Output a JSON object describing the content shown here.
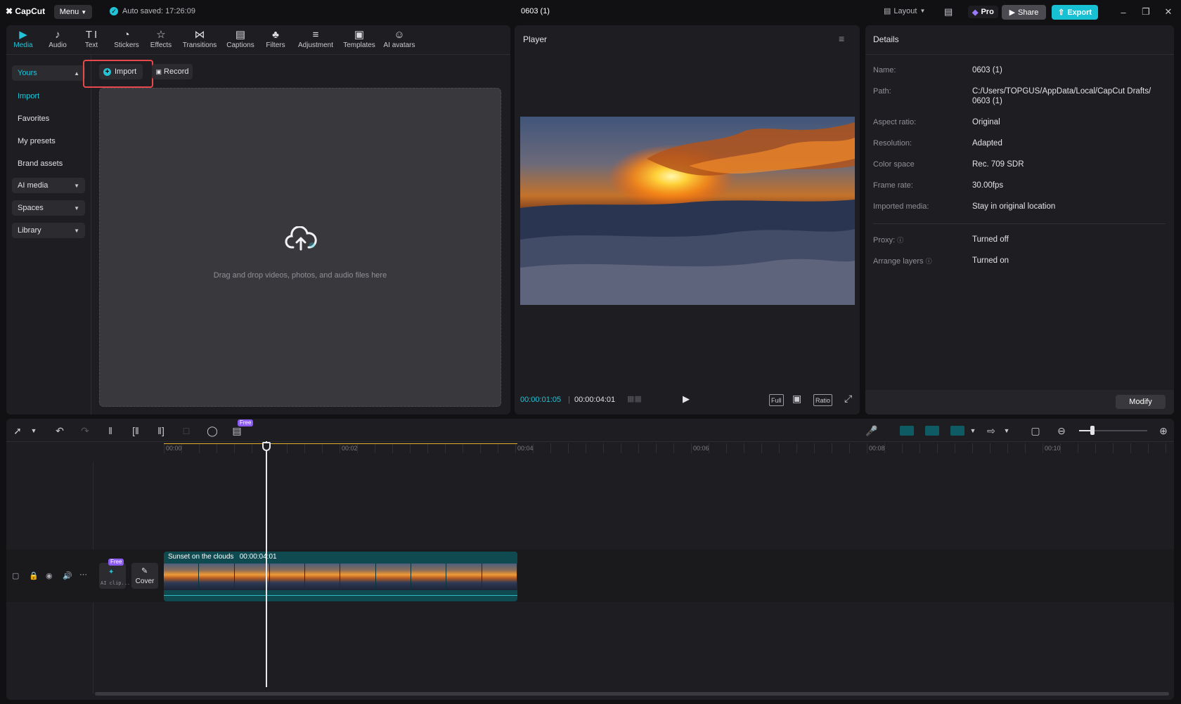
{
  "app": {
    "brand": "CapCut",
    "menu_label": "Menu",
    "autosave": "Auto saved: 17:26:09",
    "doc_title": "0603 (1)",
    "layout_label": "Layout",
    "pro_label": "Pro",
    "share_label": "Share",
    "export_label": "Export",
    "accent_color": "#22c3d6"
  },
  "tabs": [
    {
      "label": "Media",
      "icon": "media-icon"
    },
    {
      "label": "Audio",
      "icon": "audio-icon"
    },
    {
      "label": "Text",
      "icon": "text-icon"
    },
    {
      "label": "Stickers",
      "icon": "stickers-icon"
    },
    {
      "label": "Effects",
      "icon": "effects-icon"
    },
    {
      "label": "Transitions",
      "icon": "transitions-icon"
    },
    {
      "label": "Captions",
      "icon": "captions-icon"
    },
    {
      "label": "Filters",
      "icon": "filters-icon"
    },
    {
      "label": "Adjustment",
      "icon": "adjustment-icon"
    },
    {
      "label": "Templates",
      "icon": "templates-icon"
    },
    {
      "label": "AI avatars",
      "icon": "ai-avatars-icon"
    }
  ],
  "sidebar": {
    "yours": "Yours",
    "items": [
      "Import",
      "Favorites",
      "My presets",
      "Brand assets"
    ],
    "groups": [
      "AI media",
      "Spaces",
      "Library"
    ]
  },
  "media": {
    "import_label": "Import",
    "record_label": "Record",
    "drop_hint": "Drag and drop videos, photos, and audio files here"
  },
  "player": {
    "title": "Player",
    "current_time": "00:00:01:05",
    "total_time": "00:00:04:01",
    "full_label": "Full",
    "ratio_label": "Ratio"
  },
  "details": {
    "title": "Details",
    "rows": [
      {
        "label": "Name:",
        "value": "0603 (1)"
      },
      {
        "label": "Path:",
        "value": "C:/Users/TOPGUS/AppData/Local/CapCut Drafts/ 0603 (1)"
      },
      {
        "label": "Aspect ratio:",
        "value": "Original"
      },
      {
        "label": "Resolution:",
        "value": "Adapted"
      },
      {
        "label": "Color space",
        "value": "Rec. 709 SDR"
      },
      {
        "label": "Frame rate:",
        "value": "30.00fps"
      },
      {
        "label": "Imported media:",
        "value": "Stay in original location"
      }
    ],
    "rows2": [
      {
        "label": "Proxy:",
        "value": "Turned off"
      },
      {
        "label": "Arrange layers",
        "value": "Turned on"
      }
    ],
    "modify_label": "Modify"
  },
  "timeline": {
    "free_badge": "Free",
    "ticks": [
      "00:00",
      "00:02",
      "00:04",
      "00:06",
      "00:08",
      "00:10"
    ],
    "clip_name": "Sunset on the clouds",
    "clip_duration": "00:00:04:01",
    "cover_label": "Cover",
    "ai_clip_label": "AI clip...",
    "track_free_badge": "Free"
  }
}
